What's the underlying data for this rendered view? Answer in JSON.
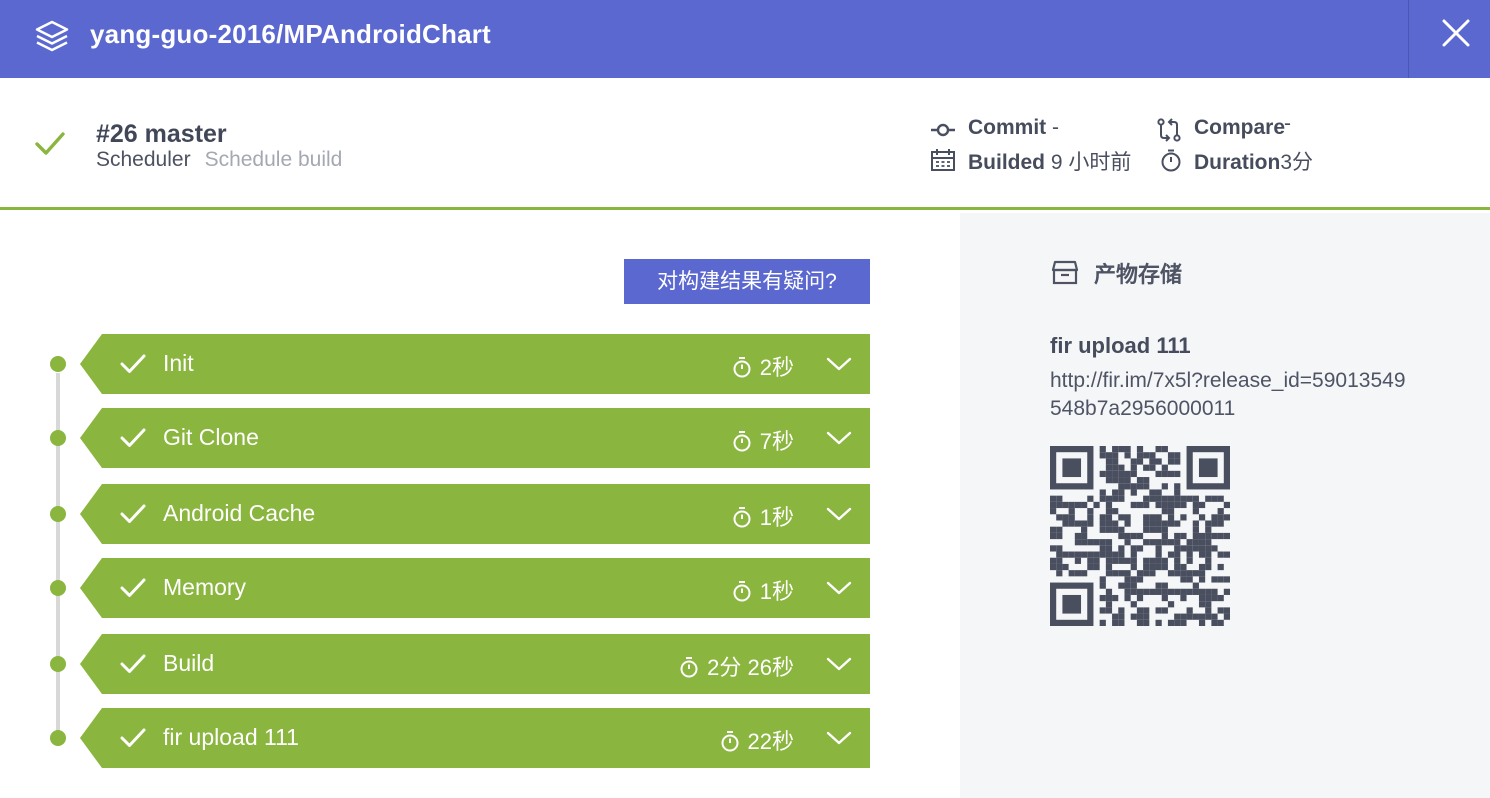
{
  "header": {
    "repo_title": "yang-guo-2016/MPAndroidChart",
    "logo_icon": "layers-icon",
    "close_icon": "close-icon",
    "bg_color": "#5b68cf"
  },
  "build": {
    "title": "#26 master",
    "trigger": "Scheduler",
    "trigger_desc": "Schedule build",
    "status_icon": "check-icon",
    "status_color": "#8ab53f",
    "commit_label": "Commit",
    "commit_value": "-",
    "compare_label": "Compare",
    "compare_value": "-",
    "builded_label": "Builded",
    "builded_value": "9 小时前",
    "duration_label": "Duration",
    "duration_value": "3分"
  },
  "question_button": "对构建结果有疑问?",
  "stages": [
    {
      "name": "Init",
      "duration": "2秒"
    },
    {
      "name": "Git Clone",
      "duration": "7秒"
    },
    {
      "name": "Android Cache",
      "duration": "1秒"
    },
    {
      "name": "Memory",
      "duration": "1秒"
    },
    {
      "name": "Build",
      "duration": "2分 26秒"
    },
    {
      "name": "fir upload 111",
      "duration": "22秒"
    }
  ],
  "artifacts": {
    "section_title": "产物存储",
    "section_icon": "archive-box-icon",
    "item_name": "fir upload 111",
    "item_url": "http://fir.im/7x5l?release_id=59013549548b7a2956000011",
    "qr_icon": "qr-code-icon"
  },
  "colors": {
    "accent": "#5b68cf",
    "success": "#8ab53f",
    "panel_bg": "#f5f6f8",
    "qr_color": "#4a4f60"
  }
}
